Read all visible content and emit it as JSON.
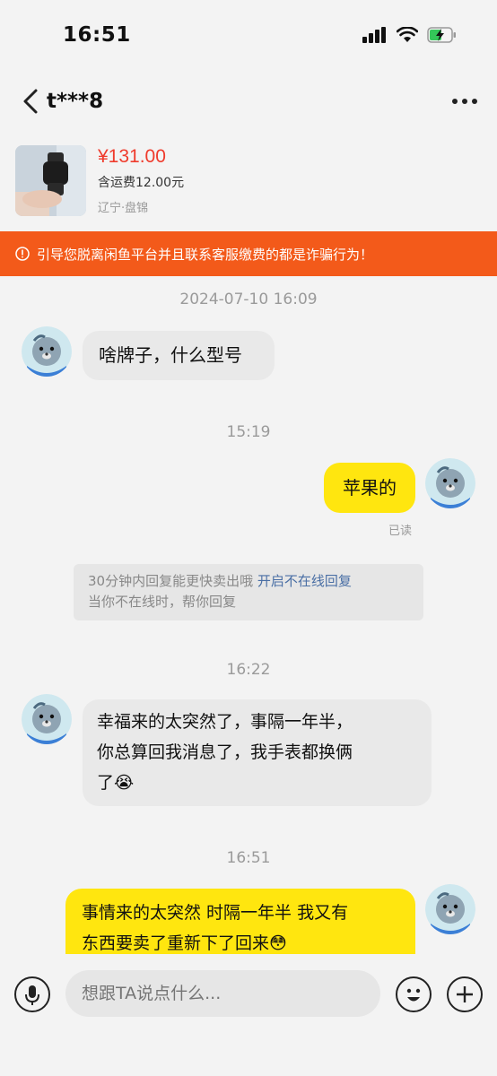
{
  "status_bar": {
    "time": "16:51"
  },
  "header": {
    "contact_name": "t***8"
  },
  "product": {
    "price": "¥131.00",
    "shipping": "含运费12.00元",
    "location": "辽宁·盘锦"
  },
  "warning": {
    "text": "引导您脱离闲鱼平台并且联系客服缴费的都是诈骗行为！"
  },
  "messages": {
    "ts1": "2024-07-10 16:09",
    "m1": "啥牌子，什么型号",
    "ts2": "15:19",
    "m2": "苹果的",
    "read_receipt": "已读",
    "notice_line1": "30分钟内回复能更快卖出哦",
    "notice_link": "开启不在线回复",
    "notice_line2": "当你不在线时，帮你回复",
    "ts3": "16:22",
    "m3_line1": "幸福来的太突然了，事隔一年半，",
    "m3_line2": "你总算回我消息了，我手表都换俩",
    "m3_line3": "了",
    "m3_emoji": "😭",
    "ts4": "16:51",
    "m4_line1": "事情来的太突然 时隔一年半 我又有",
    "m4_line2": "东西要卖了重新下了回来",
    "m4_emoji": "😳"
  },
  "input": {
    "placeholder": "想跟TA说点什么..."
  },
  "icons": {
    "signal": "signal-icon",
    "wifi": "wifi-icon",
    "battery": "battery-charging-icon",
    "back": "back-chevron-icon",
    "more": "more-dots-icon",
    "mic": "microphone-icon",
    "emoji": "emoji-icon",
    "plus": "plus-icon"
  },
  "colors": {
    "price": "#ef3b2c",
    "warning_bg": "#f35a1a",
    "my_bubble": "#ffe60f",
    "their_bubble": "#e9e9e9",
    "background": "#f3f3f3"
  }
}
